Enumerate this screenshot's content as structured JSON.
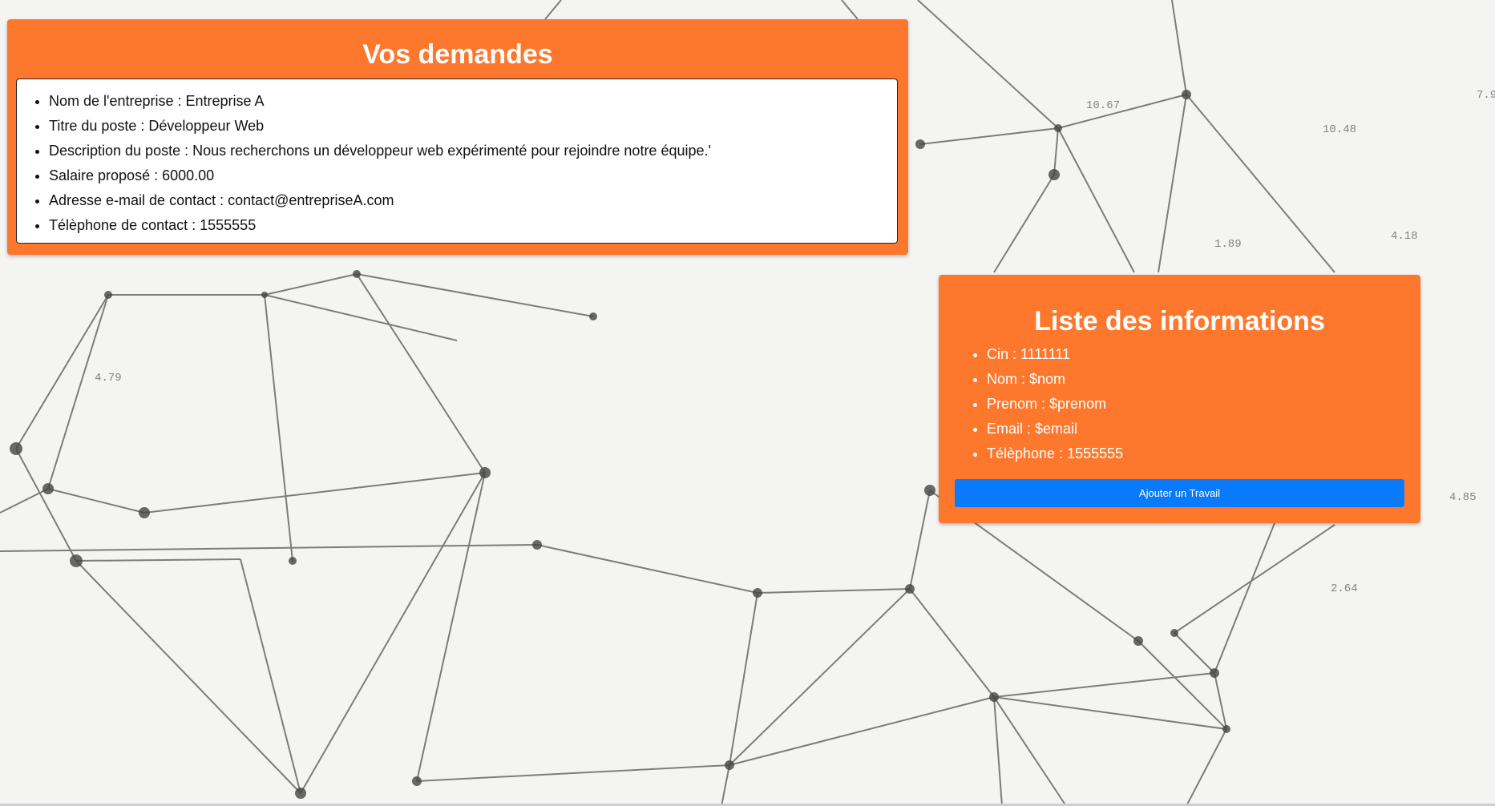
{
  "demandes": {
    "title": "Vos demandes",
    "items": [
      "Nom de l'entreprise : Entreprise A",
      "Titre du poste : Développeur Web",
      "Description du poste : Nous recherchons un développeur web expérimenté pour rejoindre notre équipe.'",
      "Salaire proposé : 6000.00",
      "Adresse e-mail de contact : contact@entrepriseA.com",
      "Télèphone de contact : 1555555"
    ]
  },
  "informations": {
    "title": "Liste des informations",
    "items": [
      "Cin : 1111111",
      "Nom : $nom",
      "Prenom : $prenom",
      "Email : $email",
      "Télèphone : 1555555"
    ],
    "button_label": "Ajouter un Travail"
  },
  "background_labels": [
    "10.67",
    "7.9",
    "10.48",
    "4.79",
    "4.85",
    "2.64",
    "1.89",
    "4.18"
  ],
  "colors": {
    "panel": "#fd772c",
    "button": "#0a7afc",
    "text_light": "#ffffff"
  }
}
